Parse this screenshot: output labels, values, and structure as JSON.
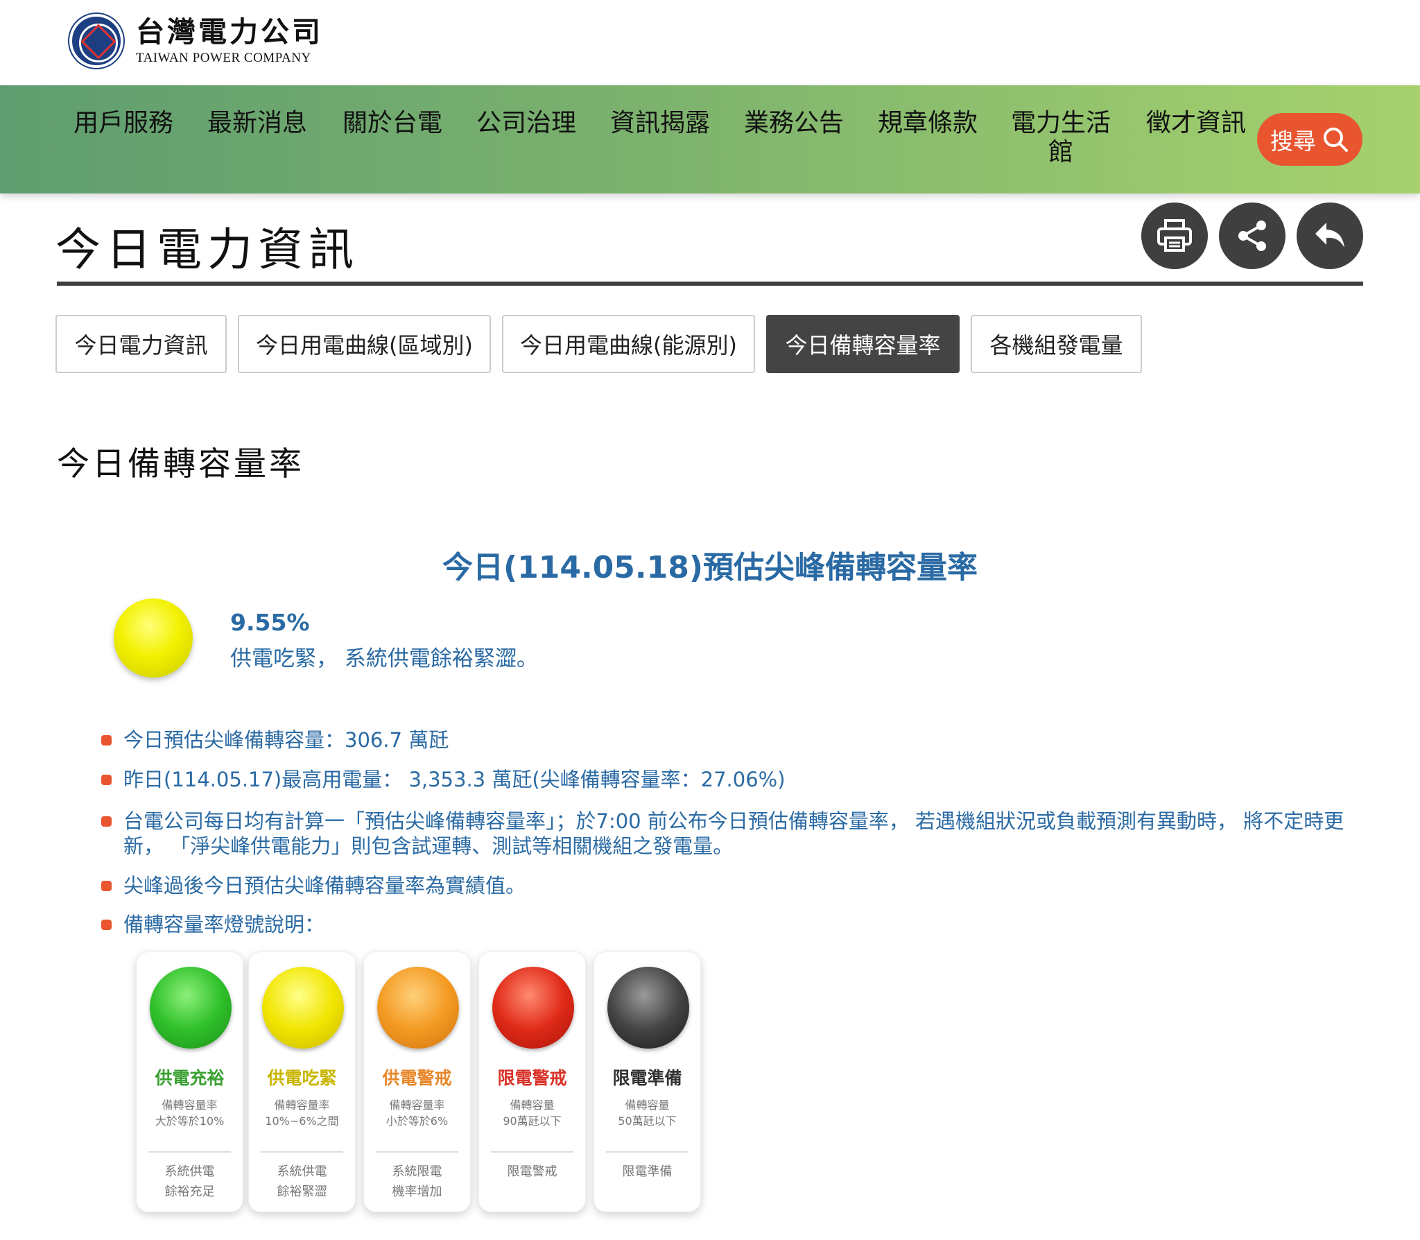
{
  "header": {
    "logo_zh": "台灣電力公司",
    "logo_en": "TAIWAN POWER COMPANY"
  },
  "nav": {
    "items": [
      "用戶服務",
      "最新消息",
      "關於台電",
      "公司治理",
      "資訊揭露",
      "業務公告",
      "規章條款",
      "電力生活館",
      "徵才資訊"
    ],
    "search_label": "搜尋"
  },
  "page": {
    "title": "今日電力資訊",
    "actions": [
      "print-icon",
      "share-icon",
      "back-icon"
    ]
  },
  "tabs": [
    {
      "label": "今日電力資訊",
      "active": false
    },
    {
      "label": "今日用電曲線(區域別)",
      "active": false
    },
    {
      "label": "今日用電曲線(能源別)",
      "active": false
    },
    {
      "label": "今日備轉容量率",
      "active": true
    },
    {
      "label": "各機組發電量",
      "active": false
    }
  ],
  "content": {
    "section_title": "今日備轉容量率",
    "headline": "今日(114.05.18)預估尖峰備轉容量率",
    "rate": "9.55%",
    "rate_desc": "供電吃緊， 系統供電餘裕緊澀。",
    "bullets": [
      "今日預估尖峰備轉容量：306.7 萬瓩",
      "昨日(114.05.17)最高用電量： 3,353.3 萬瓩(尖峰備轉容量率：27.06%)",
      "台電公司每日均有計算一「預估尖峰備轉容量率」；於7:00 前公布今日預估備轉容量率， 若遇機組狀況或負載預測有異動時， 將不定時更新， 「淨尖峰供電能力」則包含試運轉、測試等相關機組之發電量。",
      "尖峰過後今日預估尖峰備轉容量率為實績值。",
      "備轉容量率燈號說明："
    ]
  },
  "legend": [
    {
      "title": "供電充裕",
      "color": "#3aa032",
      "bulb": "green",
      "sub1": "備轉容量率",
      "sub2": "大於等於10%",
      "foot1": "系統供電",
      "foot2": "餘裕充足"
    },
    {
      "title": "供電吃緊",
      "color": "#c9b500",
      "bulb": "yellow",
      "sub1": "備轉容量率",
      "sub2": "10%~6%之間",
      "foot1": "系統供電",
      "foot2": "餘裕緊澀"
    },
    {
      "title": "供電警戒",
      "color": "#e8872a",
      "bulb": "orange",
      "sub1": "備轉容量率",
      "sub2": "小於等於6%",
      "foot1": "系統限電",
      "foot2": "機率增加"
    },
    {
      "title": "限電警戒",
      "color": "#d93228",
      "bulb": "red",
      "sub1": "備轉容量",
      "sub2": "90萬瓩以下",
      "foot1": "限電警戒",
      "foot2": ""
    },
    {
      "title": "限電準備",
      "color": "#333333",
      "bulb": "black",
      "sub1": "備轉容量",
      "sub2": "50萬瓩以下",
      "foot1": "限電準備",
      "foot2": ""
    }
  ]
}
